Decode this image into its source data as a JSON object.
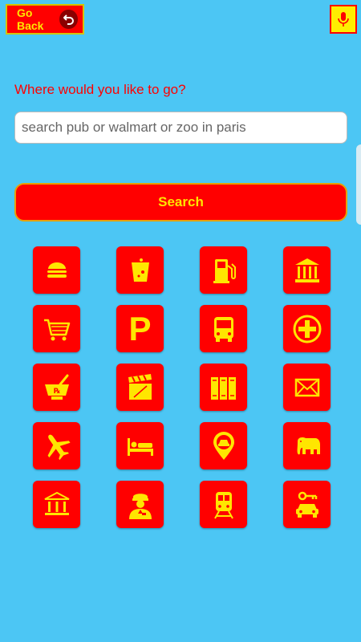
{
  "header": {
    "back_label": "Go Back",
    "back_icon": "undo-arrow-icon",
    "mic_icon": "microphone-icon"
  },
  "search": {
    "prompt": "Where would you like to go?",
    "placeholder": "search pub or walmart or zoo in paris",
    "button_label": "Search"
  },
  "categories": [
    {
      "icon": "burger-icon"
    },
    {
      "icon": "drink-icon"
    },
    {
      "icon": "fuel-pump-icon"
    },
    {
      "icon": "bank-icon"
    },
    {
      "icon": "shopping-cart-icon"
    },
    {
      "icon": "parking-icon",
      "glyph": "P"
    },
    {
      "icon": "bus-icon"
    },
    {
      "icon": "hospital-icon"
    },
    {
      "icon": "pharmacy-icon",
      "glyph": "℞"
    },
    {
      "icon": "clapperboard-icon"
    },
    {
      "icon": "library-icon"
    },
    {
      "icon": "mail-icon"
    },
    {
      "icon": "airplane-icon"
    },
    {
      "icon": "hotel-bed-icon"
    },
    {
      "icon": "taxi-pin-icon"
    },
    {
      "icon": "elephant-icon"
    },
    {
      "icon": "museum-icon"
    },
    {
      "icon": "police-icon"
    },
    {
      "icon": "train-icon"
    },
    {
      "icon": "car-rental-icon"
    }
  ],
  "colors": {
    "background": "#4cc6f4",
    "accent": "#ff0000",
    "icon": "#ffe600"
  }
}
